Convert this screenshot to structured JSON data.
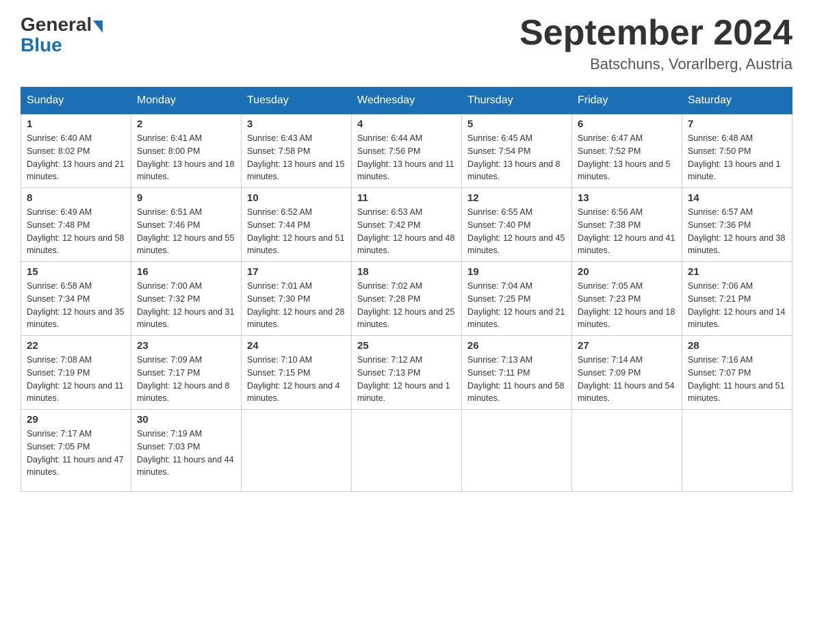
{
  "header": {
    "logo_general": "General",
    "logo_blue": "Blue",
    "month_title": "September 2024",
    "location": "Batschuns, Vorarlberg, Austria"
  },
  "weekdays": [
    "Sunday",
    "Monday",
    "Tuesday",
    "Wednesday",
    "Thursday",
    "Friday",
    "Saturday"
  ],
  "weeks": [
    [
      {
        "day": "1",
        "sunrise": "6:40 AM",
        "sunset": "8:02 PM",
        "daylight": "13 hours and 21 minutes."
      },
      {
        "day": "2",
        "sunrise": "6:41 AM",
        "sunset": "8:00 PM",
        "daylight": "13 hours and 18 minutes."
      },
      {
        "day": "3",
        "sunrise": "6:43 AM",
        "sunset": "7:58 PM",
        "daylight": "13 hours and 15 minutes."
      },
      {
        "day": "4",
        "sunrise": "6:44 AM",
        "sunset": "7:56 PM",
        "daylight": "13 hours and 11 minutes."
      },
      {
        "day": "5",
        "sunrise": "6:45 AM",
        "sunset": "7:54 PM",
        "daylight": "13 hours and 8 minutes."
      },
      {
        "day": "6",
        "sunrise": "6:47 AM",
        "sunset": "7:52 PM",
        "daylight": "13 hours and 5 minutes."
      },
      {
        "day": "7",
        "sunrise": "6:48 AM",
        "sunset": "7:50 PM",
        "daylight": "13 hours and 1 minute."
      }
    ],
    [
      {
        "day": "8",
        "sunrise": "6:49 AM",
        "sunset": "7:48 PM",
        "daylight": "12 hours and 58 minutes."
      },
      {
        "day": "9",
        "sunrise": "6:51 AM",
        "sunset": "7:46 PM",
        "daylight": "12 hours and 55 minutes."
      },
      {
        "day": "10",
        "sunrise": "6:52 AM",
        "sunset": "7:44 PM",
        "daylight": "12 hours and 51 minutes."
      },
      {
        "day": "11",
        "sunrise": "6:53 AM",
        "sunset": "7:42 PM",
        "daylight": "12 hours and 48 minutes."
      },
      {
        "day": "12",
        "sunrise": "6:55 AM",
        "sunset": "7:40 PM",
        "daylight": "12 hours and 45 minutes."
      },
      {
        "day": "13",
        "sunrise": "6:56 AM",
        "sunset": "7:38 PM",
        "daylight": "12 hours and 41 minutes."
      },
      {
        "day": "14",
        "sunrise": "6:57 AM",
        "sunset": "7:36 PM",
        "daylight": "12 hours and 38 minutes."
      }
    ],
    [
      {
        "day": "15",
        "sunrise": "6:58 AM",
        "sunset": "7:34 PM",
        "daylight": "12 hours and 35 minutes."
      },
      {
        "day": "16",
        "sunrise": "7:00 AM",
        "sunset": "7:32 PM",
        "daylight": "12 hours and 31 minutes."
      },
      {
        "day": "17",
        "sunrise": "7:01 AM",
        "sunset": "7:30 PM",
        "daylight": "12 hours and 28 minutes."
      },
      {
        "day": "18",
        "sunrise": "7:02 AM",
        "sunset": "7:28 PM",
        "daylight": "12 hours and 25 minutes."
      },
      {
        "day": "19",
        "sunrise": "7:04 AM",
        "sunset": "7:25 PM",
        "daylight": "12 hours and 21 minutes."
      },
      {
        "day": "20",
        "sunrise": "7:05 AM",
        "sunset": "7:23 PM",
        "daylight": "12 hours and 18 minutes."
      },
      {
        "day": "21",
        "sunrise": "7:06 AM",
        "sunset": "7:21 PM",
        "daylight": "12 hours and 14 minutes."
      }
    ],
    [
      {
        "day": "22",
        "sunrise": "7:08 AM",
        "sunset": "7:19 PM",
        "daylight": "12 hours and 11 minutes."
      },
      {
        "day": "23",
        "sunrise": "7:09 AM",
        "sunset": "7:17 PM",
        "daylight": "12 hours and 8 minutes."
      },
      {
        "day": "24",
        "sunrise": "7:10 AM",
        "sunset": "7:15 PM",
        "daylight": "12 hours and 4 minutes."
      },
      {
        "day": "25",
        "sunrise": "7:12 AM",
        "sunset": "7:13 PM",
        "daylight": "12 hours and 1 minute."
      },
      {
        "day": "26",
        "sunrise": "7:13 AM",
        "sunset": "7:11 PM",
        "daylight": "11 hours and 58 minutes."
      },
      {
        "day": "27",
        "sunrise": "7:14 AM",
        "sunset": "7:09 PM",
        "daylight": "11 hours and 54 minutes."
      },
      {
        "day": "28",
        "sunrise": "7:16 AM",
        "sunset": "7:07 PM",
        "daylight": "11 hours and 51 minutes."
      }
    ],
    [
      {
        "day": "29",
        "sunrise": "7:17 AM",
        "sunset": "7:05 PM",
        "daylight": "11 hours and 47 minutes."
      },
      {
        "day": "30",
        "sunrise": "7:19 AM",
        "sunset": "7:03 PM",
        "daylight": "11 hours and 44 minutes."
      },
      null,
      null,
      null,
      null,
      null
    ]
  ],
  "labels": {
    "sunrise": "Sunrise:",
    "sunset": "Sunset:",
    "daylight": "Daylight:"
  }
}
